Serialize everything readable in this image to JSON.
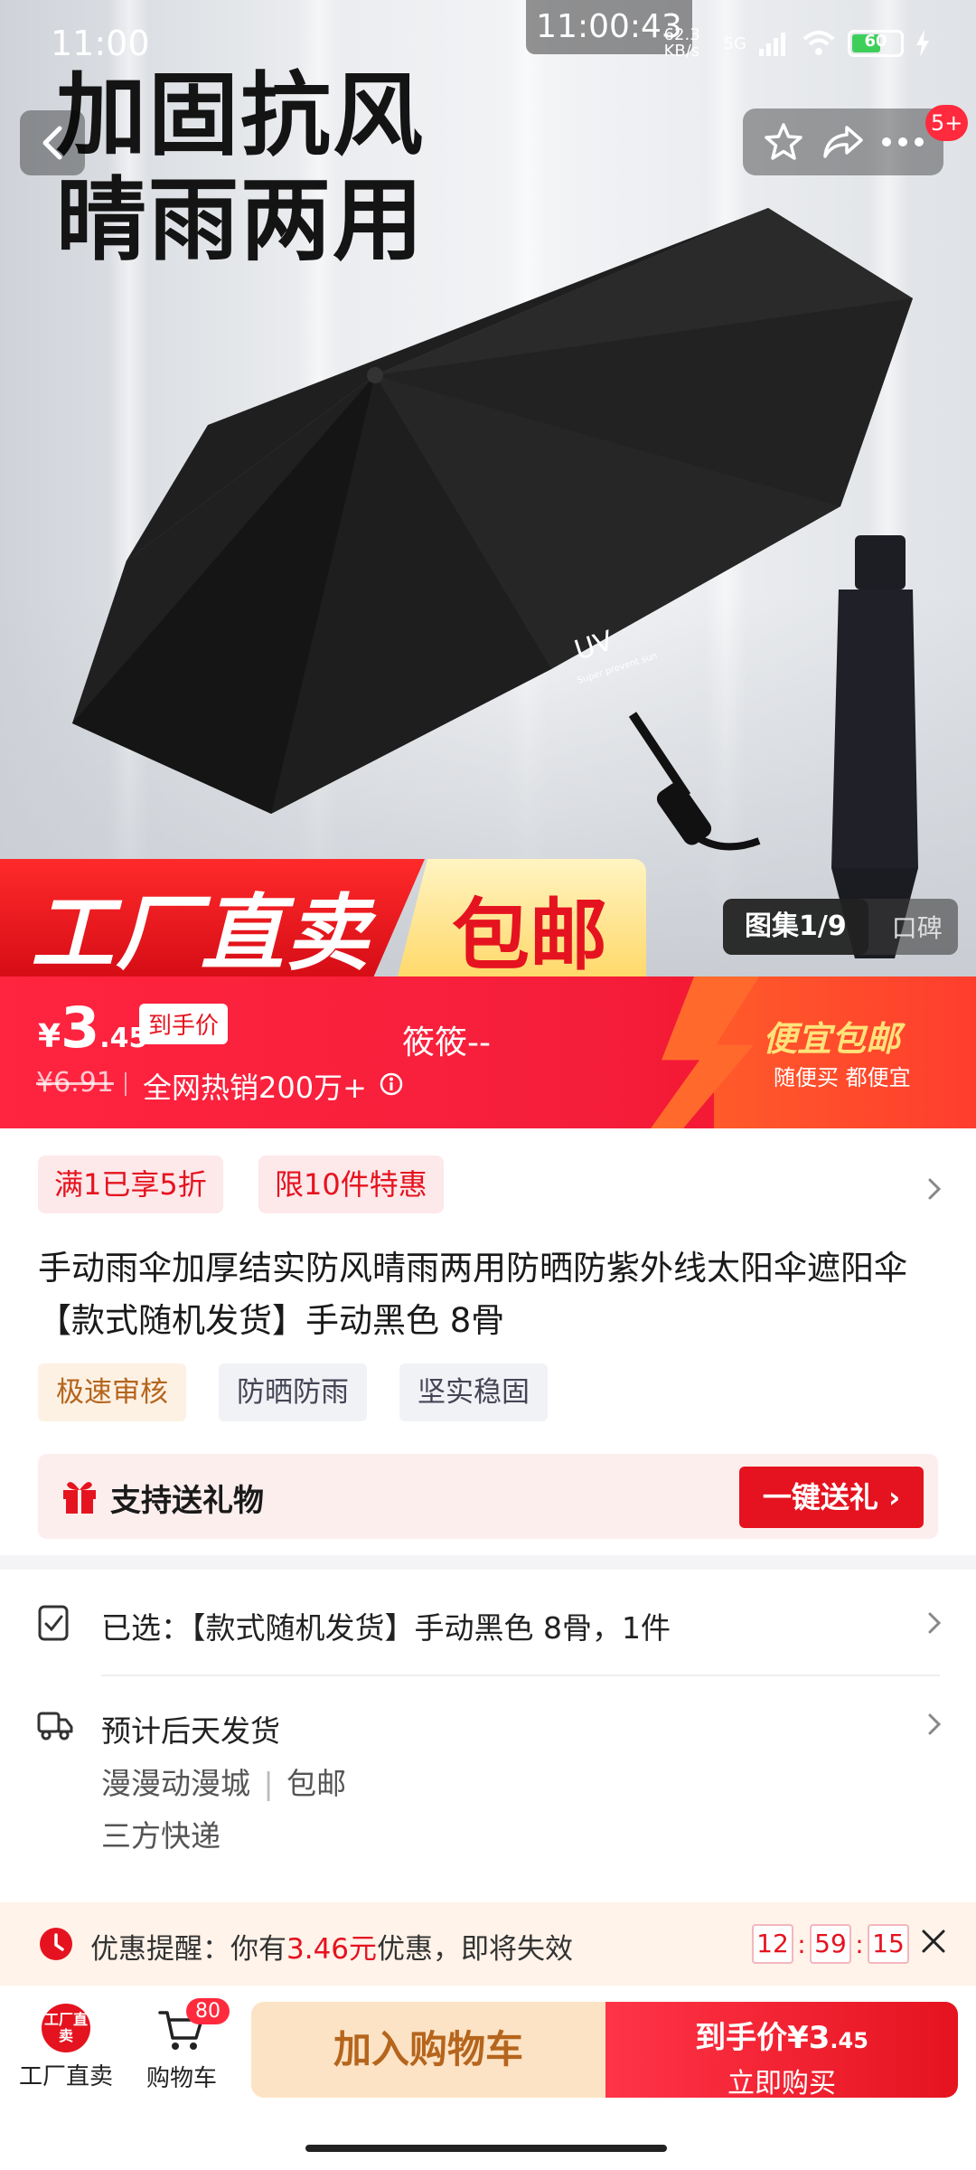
{
  "status_bar": {
    "time": "11:00",
    "clock_overlay": "11:00:43",
    "net_speed": "62.3 KB/s",
    "network": "5G",
    "battery": "60"
  },
  "hero": {
    "headline_line1": "加固抗风",
    "headline_line2": "晴雨两用",
    "umbrella_print": "UV",
    "umbrella_small_print": "Super prevent sun",
    "promo_left": "工厂直卖",
    "promo_right": "包邮",
    "gallery_active": "图集1/9",
    "gallery_other": "口碑",
    "message_badge": "5+"
  },
  "price": {
    "symbol": "¥",
    "integer": "3",
    "decimal": ".45",
    "tag": "到手价",
    "old_price": "¥6.91",
    "sales": "全网热销200万+",
    "seller": "筱筱--",
    "promo_title": "便宜包邮",
    "promo_sub": "随便买 都便宜"
  },
  "info": {
    "chip1": "满1已享5折",
    "chip2": "限10件特惠",
    "title": "手动雨伞加厚结实防风晴雨两用防晒防紫外线太阳伞遮阳伞 【款式随机发货】手动黑色 8骨",
    "tags": [
      "极速审核",
      "防晒防雨",
      "坚实稳固"
    ],
    "gift_label": "支持送礼物",
    "gift_button": "一键送礼 ›"
  },
  "selection": {
    "selected": "已选：【款式随机发货】手动黑色 8骨，1件",
    "ship_title": "预计后天发货",
    "ship_store": "漫漫动漫城",
    "ship_sep": "|",
    "ship_free": "包邮",
    "ship_carrier": "三方快递"
  },
  "coupon": {
    "prefix": "优惠提醒：你有",
    "amount": "3.46元",
    "suffix": "优惠，即将失效",
    "hh": "12",
    "mm": "59",
    "ss": "15",
    "colon": ":"
  },
  "bottom": {
    "nav_factory_badge": "工厂直卖",
    "nav_factory": "工厂直卖",
    "nav_cart": "购物车",
    "cart_count": "80",
    "add_cart": "加入购物车",
    "buy_prefix": "到手价",
    "buy_price": "¥3",
    "buy_price_dec": ".45",
    "buy_now": "立即购买"
  },
  "colors": {
    "brand_red": "#e5131f",
    "promo_gold": "#ffe27a"
  }
}
